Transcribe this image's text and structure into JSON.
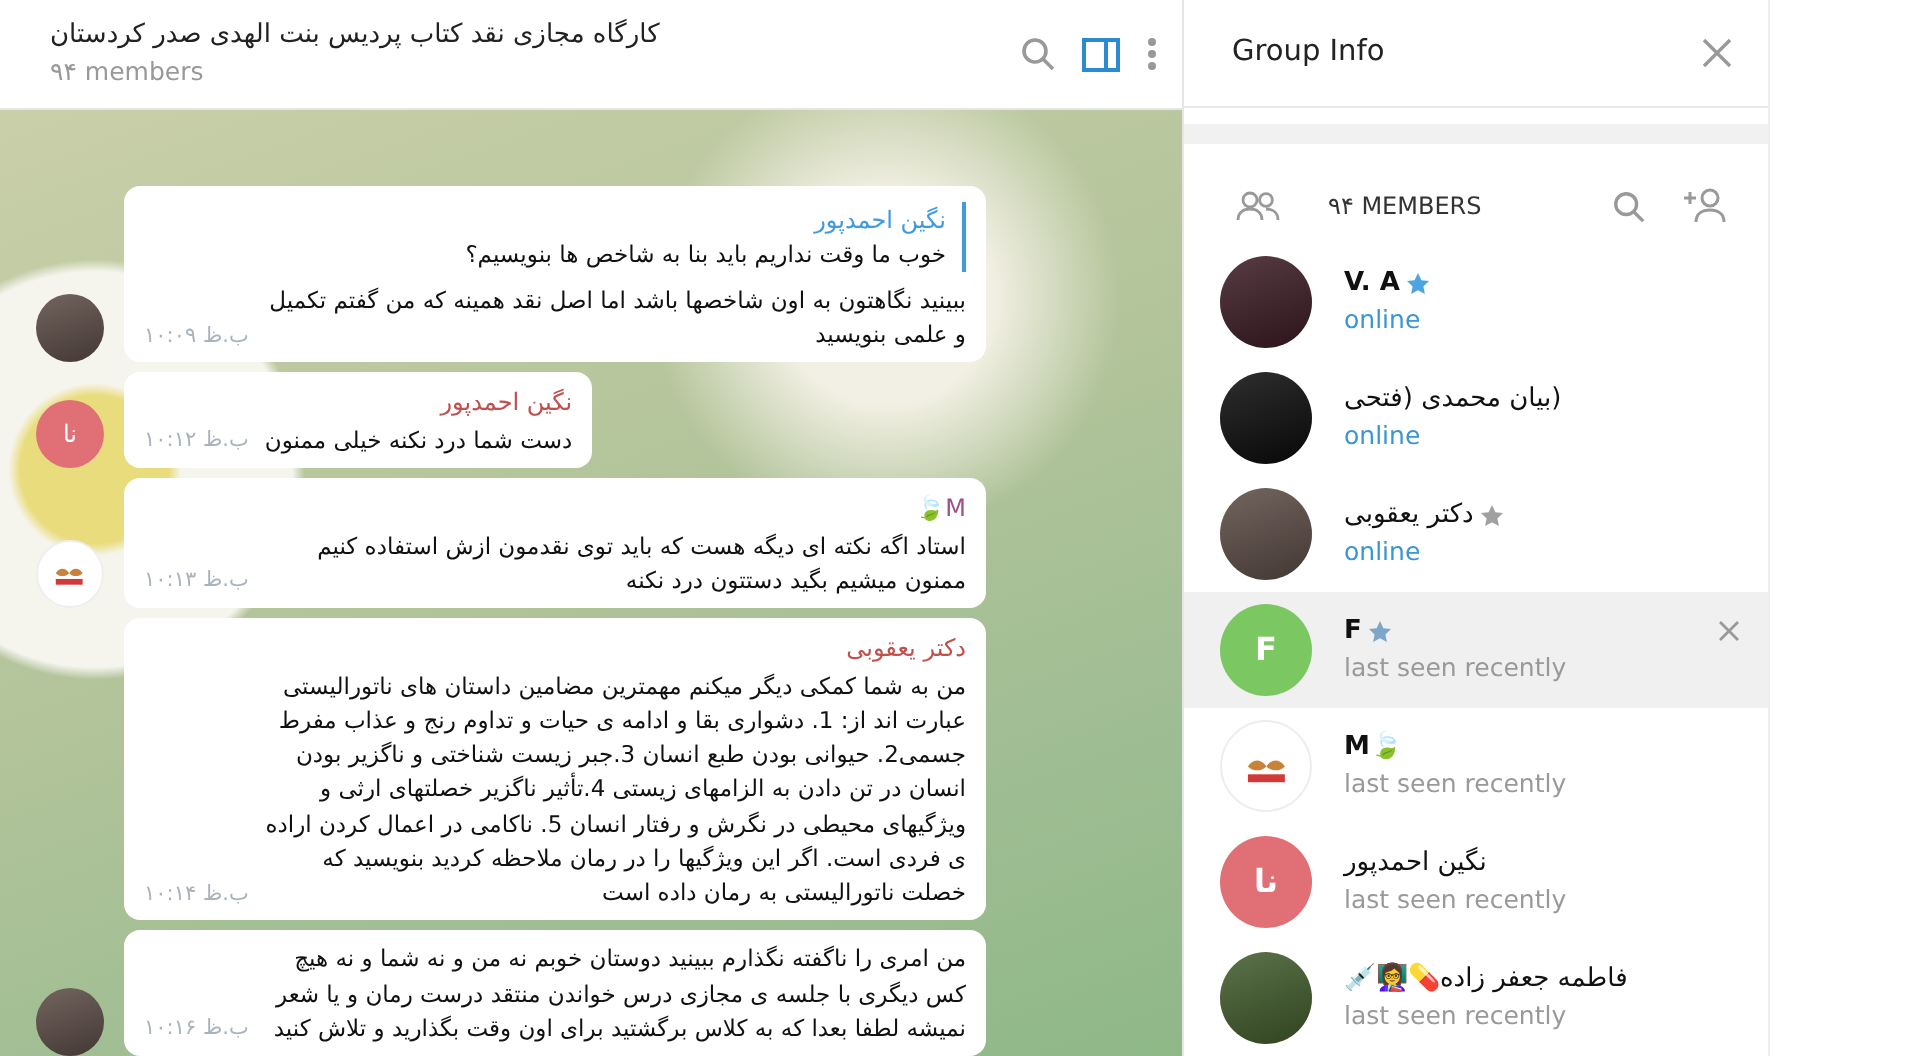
{
  "chat_header": {
    "title": "کارگاه مجازی نقد کتاب پردیس بنت الهدی صدر کردستان",
    "subtitle": "۹۴ members"
  },
  "messages": [
    {
      "reply": {
        "sender": "نگین احمدپور",
        "text": "خوب ما وقت نداریم باید بنا به شاخص ها بنویسیم؟"
      },
      "text": "ببینید نگاهتون به اون شاخصها باشد اما اصل نقد همینه که من گفتم تکمیل و علمی بنویسید",
      "time": "ب.ظ ۱۰:۰۹",
      "avatar": {
        "kind": "photo",
        "color": "#5a4a44"
      }
    },
    {
      "sender": "نگین احمدپور",
      "color": "#c0504d",
      "text": "دست شما درد نکنه خیلی ممنون",
      "time": "ب.ظ ۱۰:۱۲",
      "avatar": {
        "kind": "letters",
        "letters": "نا",
        "color": "#e17076"
      }
    },
    {
      "sender": "M🍃",
      "color": "#a0508f",
      "text": "استاد اگه نکته ای دیگه هست که باید توی نقدمون ازش استفاده کنیم ممنون میشیم بگید دستتون درد نکنه",
      "time": "ب.ظ ۱۰:۱۳",
      "avatar": {
        "kind": "logo",
        "color": "#ffffff"
      }
    },
    {
      "sender": "دکتر یعقوبی",
      "color": "#c0504d",
      "text": "من به شما کمکی دیگر میکنم مهمترین مضامین داستان های ناتورالیستی عبارت اند از: 1. دشواری بقا و ادامه ی حیات و تداوم رنج و عذاب مفرط جسمی2. حیوانی بودن طبع انسان 3.جبر زیست شناختی و ناگزیر بودن انسان در تن دادن به الزامهای زیستی 4.تأثیر ناگزیر خصلتهای ارثی و ویژگیهای محیطی در نگرش و رفتار انسان 5. ناکامی در اعمال کردن اراده ی فردی است. اگر این ویژگیها را در رمان ملاحظه کردید بنویسید که خصلت ناتورالیستی به رمان داده است",
      "time": "ب.ظ ۱۰:۱۴"
    },
    {
      "text": "من امری را ناگفته نگذارم ببینید دوستان خوبم نه من و نه شما و نه هیچ کس دیگری با جلسه ی مجازی درس خواندن منتقد درست رمان و یا شعر نمیشه لطفا بعدا که به کلاس برگشتید برای اون وقت بگذارید و تلاش کنید",
      "time": "ب.ظ ۱۰:۱۶",
      "avatar": {
        "kind": "photo",
        "color": "#5a4a44"
      }
    }
  ],
  "group_info": {
    "title": "Group Info",
    "members_count": "۹۴ MEMBERS",
    "members": [
      {
        "name": "V. A",
        "star": {
          "color": "#4ea4e0"
        },
        "status": "online",
        "online": true,
        "highlighted": false,
        "avatar": {
          "kind": "photo",
          "color": "#3a1a22"
        }
      },
      {
        "name": "(بیان محمدی (فتحی",
        "status": "online",
        "online": true,
        "highlighted": false,
        "avatar": {
          "kind": "photo",
          "color": "#0a0a0a"
        }
      },
      {
        "name": "دکتر یعقوبی",
        "star": {
          "color": "#a0a0a0"
        },
        "status": "online",
        "online": true,
        "highlighted": false,
        "avatar": {
          "kind": "photo",
          "color": "#5a4a44"
        }
      },
      {
        "name": "F",
        "star": {
          "color": "#7ea6c8"
        },
        "status": "last seen recently",
        "online": false,
        "highlighted": true,
        "avatar": {
          "kind": "letters",
          "letters": "F",
          "color": "#7bc862"
        }
      },
      {
        "name": "M🍃",
        "status": "last seen recently",
        "online": false,
        "highlighted": false,
        "avatar": {
          "kind": "logo",
          "color": "#ffffff"
        }
      },
      {
        "name": "نگین احمدپور",
        "status": "last seen recently",
        "online": false,
        "highlighted": false,
        "avatar": {
          "kind": "letters",
          "letters": "نا",
          "color": "#e17076"
        }
      },
      {
        "name": "فاطمه جعفر زاده💊👩‍🏫💉",
        "status": "last seen recently",
        "online": false,
        "highlighted": false,
        "avatar": {
          "kind": "photo",
          "color": "#3f5a2a"
        }
      }
    ]
  }
}
